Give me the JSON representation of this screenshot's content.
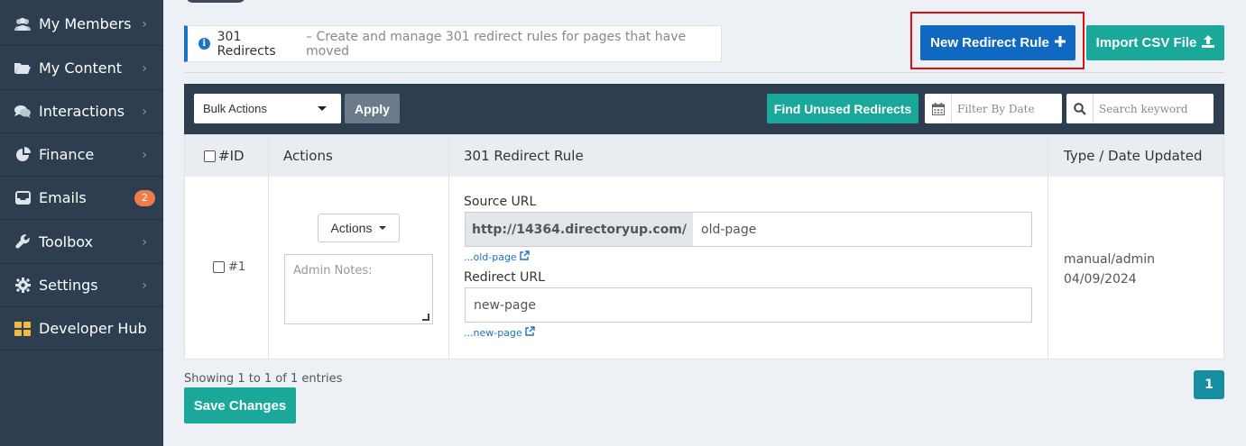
{
  "sidebar": {
    "items": [
      {
        "label": "My Members",
        "icon": "members-icon",
        "badge": null
      },
      {
        "label": "My Content",
        "icon": "folder-icon",
        "badge": null
      },
      {
        "label": "Interactions",
        "icon": "comments-icon",
        "badge": null
      },
      {
        "label": "Finance",
        "icon": "pie-chart-icon",
        "badge": null
      },
      {
        "label": "Emails",
        "icon": "inbox-icon",
        "badge": "2"
      },
      {
        "label": "Toolbox",
        "icon": "wrench-icon",
        "badge": null
      },
      {
        "label": "Settings",
        "icon": "gear-icon",
        "badge": null
      },
      {
        "label": "Developer Hub",
        "icon": "grid-icon",
        "badge": null
      }
    ]
  },
  "info": {
    "title": "301 Redirects",
    "description": "– Create and manage 301 redirect rules for pages that have moved"
  },
  "header_buttons": {
    "new_rule": "New Redirect Rule",
    "import_csv": "Import CSV File"
  },
  "toolbar": {
    "bulk_actions": "Bulk Actions",
    "apply": "Apply",
    "find_unused": "Find Unused Redirects",
    "filter_placeholder": "Filter By Date",
    "search_placeholder": "Search keyword"
  },
  "table": {
    "headers": {
      "id": "#ID",
      "actions": "Actions",
      "rule": "301 Redirect Rule",
      "type_date": "Type / Date Updated"
    },
    "rows": [
      {
        "id": "#1",
        "actions_label": "Actions",
        "notes_placeholder": "Admin Notes:",
        "source_label": "Source URL",
        "source_prefix": "http://14364.directoryup.com/",
        "source_value": "old-page",
        "source_link": "...old-page",
        "redirect_label": "Redirect URL",
        "redirect_value": "new-page",
        "redirect_link": "...new-page",
        "type": "manual/admin",
        "date": "04/09/2024"
      }
    ]
  },
  "footer": {
    "showing": "Showing 1 to 1 of 1 entries",
    "save": "Save Changes",
    "page": "1"
  },
  "colors": {
    "sidebar_bg": "#2c3e50",
    "primary_blue": "#1068c0",
    "teal": "#1aa89a",
    "highlight_red": "#e01010",
    "badge_orange": "#f07c4c"
  }
}
